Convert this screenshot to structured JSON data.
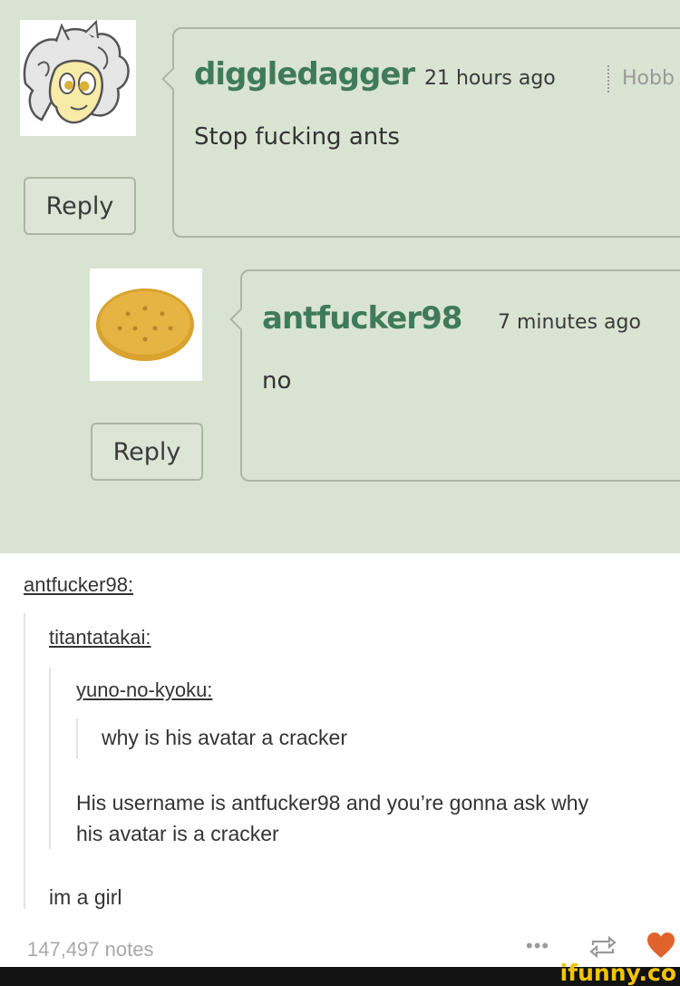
{
  "thread": {
    "comment1": {
      "username": "diggledagger",
      "time": "21 hours ago",
      "extra": "Hobb",
      "text": "Stop fucking ants",
      "reply_label": "Reply"
    },
    "comment2": {
      "username": "antfucker98",
      "time": "7 minutes ago",
      "text": "no",
      "reply_label": "Reply"
    }
  },
  "post": {
    "op_link": "antfucker98:",
    "reblog1_link": "titantatakai:",
    "reblog2_link": "yuno-no-kyoku:",
    "quote_text": "why is his avatar a cracker",
    "reply_line1": "His username is antfucker98 and you’re gonna ask why",
    "reply_line2": "his avatar is a cracker",
    "final_text": "im a girl",
    "notes": "147,497 notes"
  },
  "footer": {
    "icons": [
      "more-icon",
      "reblog-icon",
      "heart-icon"
    ],
    "watermark": "ifunny.co",
    "watermark_color": "#f5c400",
    "heart_color": "#e0622c"
  }
}
